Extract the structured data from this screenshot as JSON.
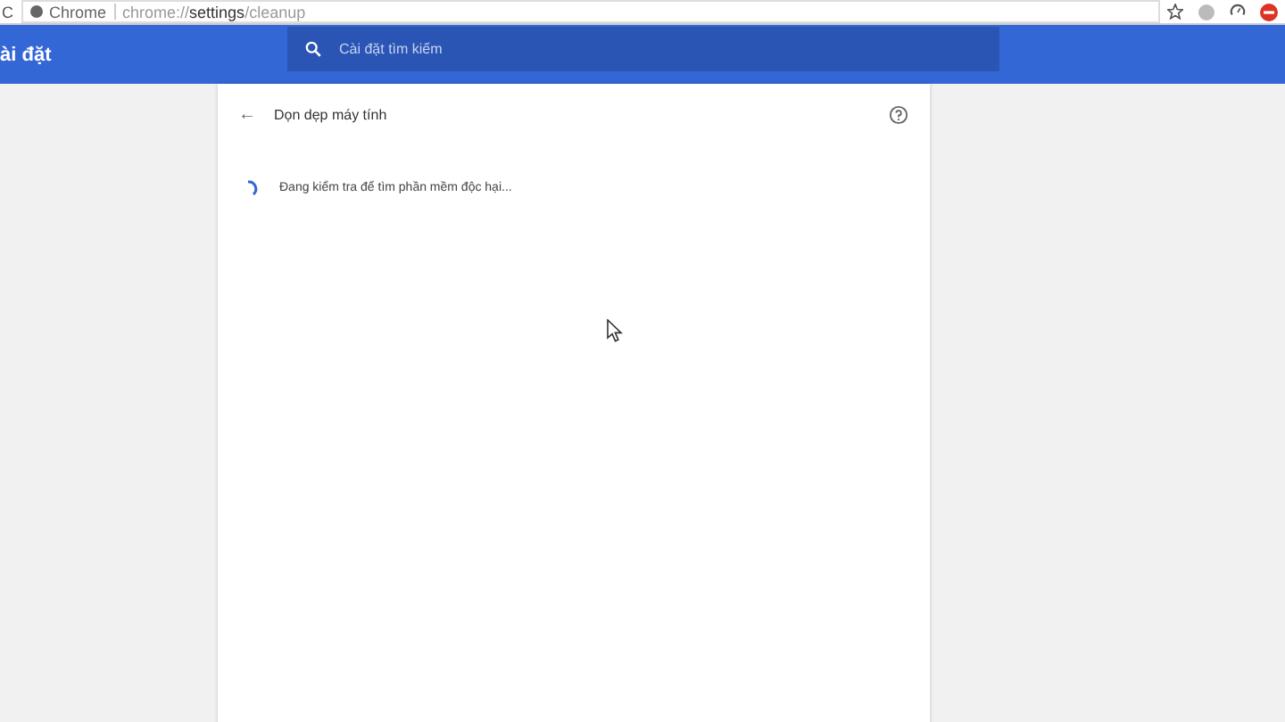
{
  "toolbar": {
    "reload": "C",
    "site_label": "Chrome",
    "url": "chrome://**settings**/cleanup"
  },
  "header": {
    "title": "ài đặt",
    "search": {
      "placeholder": "Cài đặt tìm kiếm"
    }
  },
  "page": {
    "back": "←",
    "title": "Dọn dẹp máy tính",
    "status": "Đang kiểm tra để tìm phần mềm độc hại..."
  }
}
